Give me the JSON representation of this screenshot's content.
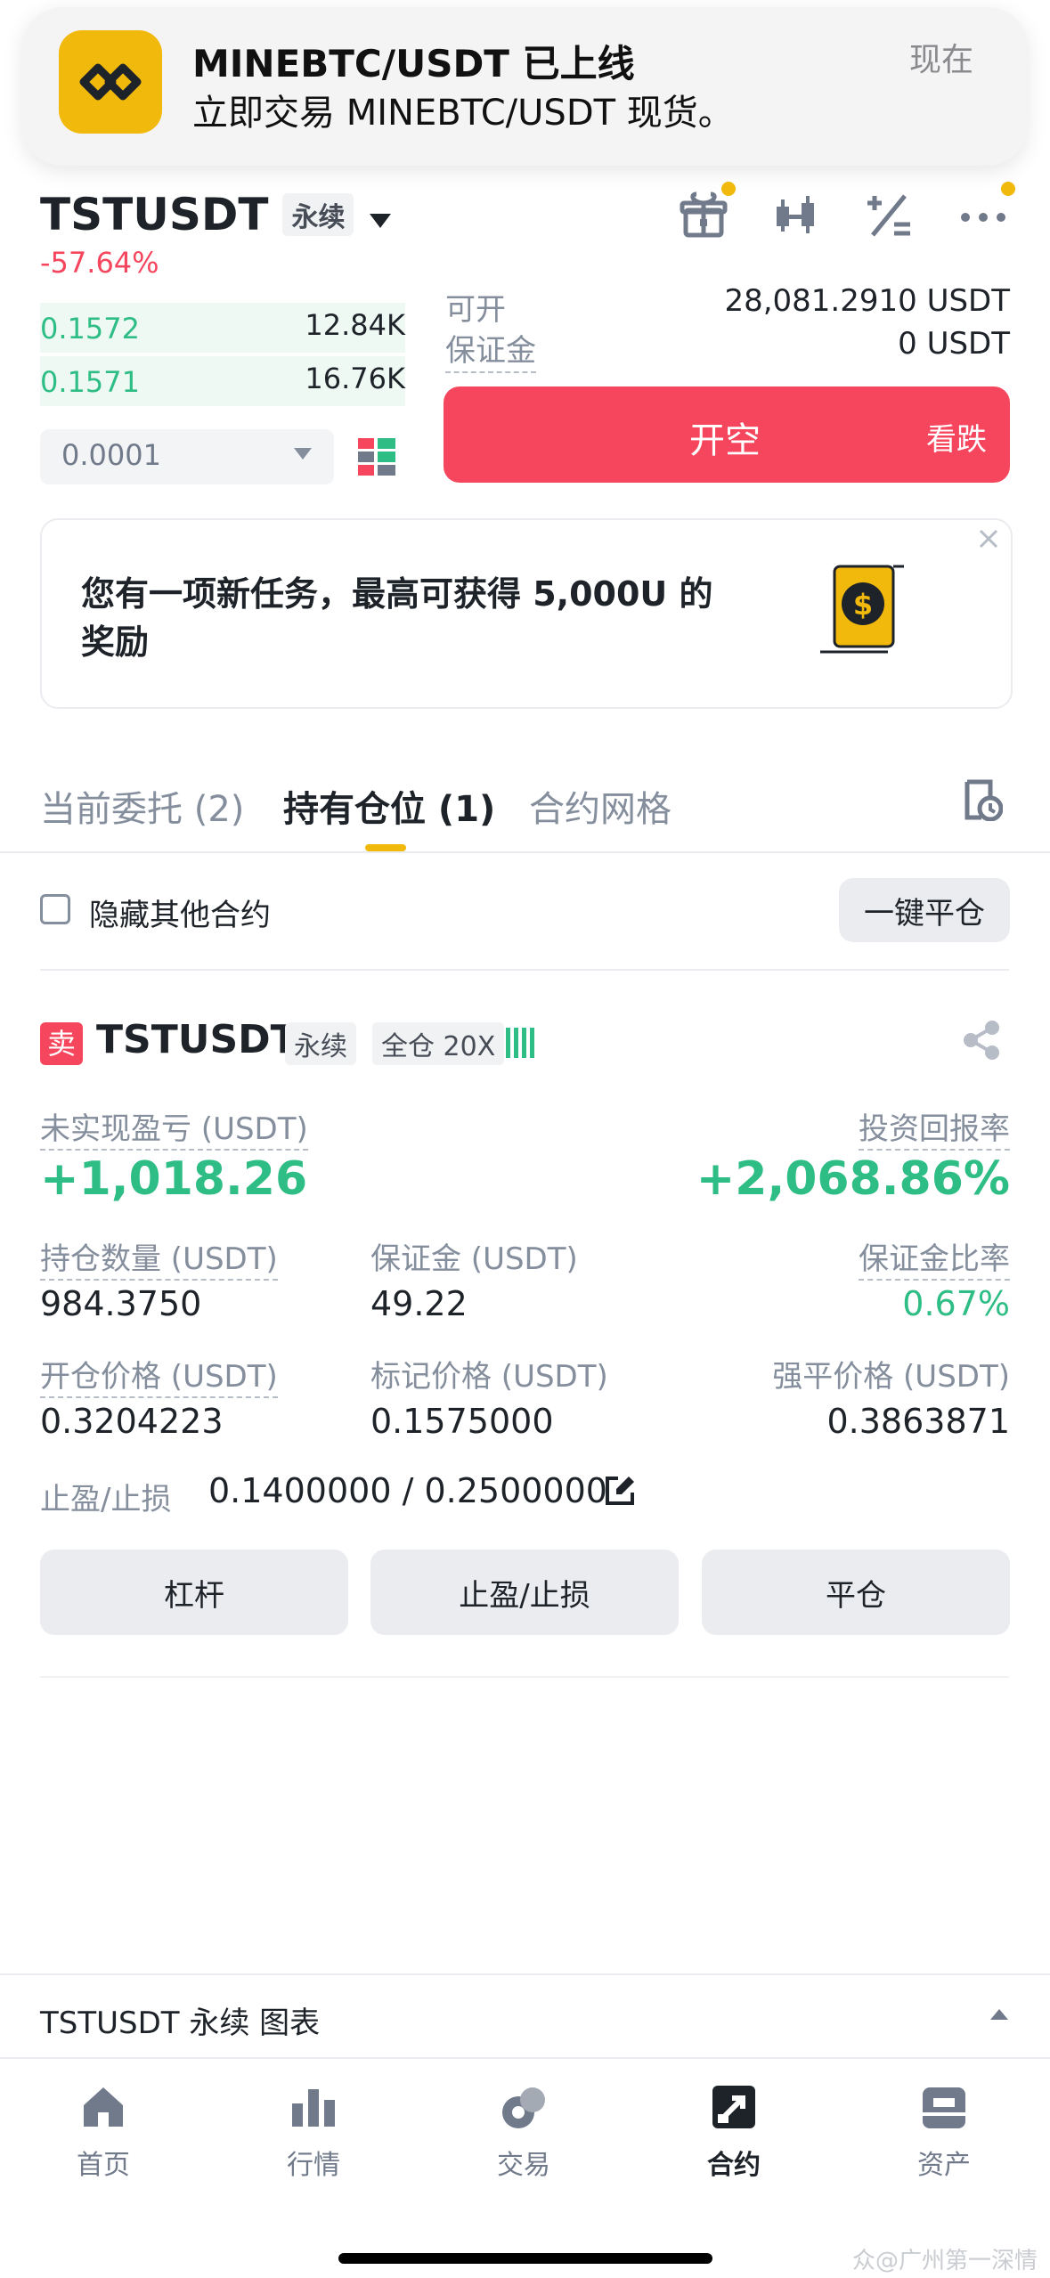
{
  "notification": {
    "title": "MINEBTC/USDT 已上线",
    "body": "立即交易 MINEBTC/USDT 现货。",
    "time": "现在"
  },
  "header": {
    "pair": "TSTUSDT",
    "type_tag": "永续",
    "change": "-57.64%"
  },
  "orderbook": {
    "rows": [
      {
        "price": "0.1572",
        "qty": "12.84K"
      },
      {
        "price": "0.1571",
        "qty": "16.76K"
      }
    ],
    "precision": "0.0001"
  },
  "order_panel": {
    "available_label": "可开",
    "available_value": "28,081.2910 USDT",
    "margin_label": "保证金",
    "margin_value": "0 USDT",
    "open_short_label": "开空",
    "bearish_label": "看跌"
  },
  "task_banner": {
    "line1": "您有一项新任务，最高可获得 5,000U 的",
    "line2": "奖励"
  },
  "tabs": {
    "open_orders": "当前委托 (2)",
    "positions": "持有仓位 (1)",
    "grid": "合约网格"
  },
  "filters": {
    "hide_other": "隐藏其他合约",
    "close_all": "一键平仓"
  },
  "position": {
    "side_badge": "卖",
    "pair": "TSTUSDT",
    "type_tag": "永续",
    "margin_mode": "全仓 20X",
    "unrealized_label": "未实现盈亏 (USDT)",
    "unrealized_value": "+1,018.26",
    "roi_label": "投资回报率",
    "roi_value": "+2,068.86%",
    "size_label": "持仓数量 (USDT)",
    "size_value": "984.3750",
    "margin_label": "保证金 (USDT)",
    "margin_value": "49.22",
    "margin_ratio_label": "保证金比率",
    "margin_ratio_value": "0.67%",
    "entry_label": "开仓价格 (USDT)",
    "entry_value": "0.3204223",
    "mark_label": "标记价格 (USDT)",
    "mark_value": "0.1575000",
    "liq_label": "强平价格 (USDT)",
    "liq_value": "0.3863871",
    "tpsl_label": "止盈/止损",
    "tpsl_value": "0.1400000 / 0.2500000",
    "btn_leverage": "杠杆",
    "btn_tpsl": "止盈/止损",
    "btn_close": "平仓"
  },
  "chart_bar": {
    "label": "TSTUSDT 永续  图表"
  },
  "nav": {
    "home": "首页",
    "markets": "行情",
    "trade": "交易",
    "futures": "合约",
    "assets": "资产"
  },
  "watermark": "众@广州第一深情",
  "colors": {
    "green": "#2ebd85",
    "red": "#f6465d",
    "yellow": "#f0b90b"
  }
}
